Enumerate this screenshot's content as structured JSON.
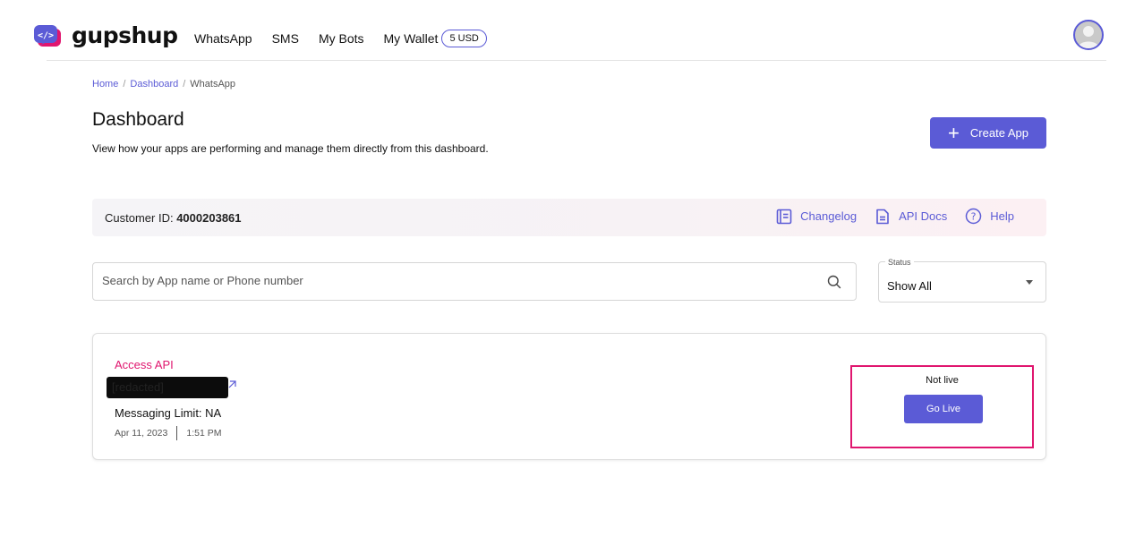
{
  "brand": {
    "name": "gupshup",
    "logo_icon": "code-bubble-icon",
    "accent": "#5b5bd6",
    "highlight": "#e0166f"
  },
  "nav": {
    "items": [
      "WhatsApp",
      "SMS",
      "My Bots"
    ],
    "wallet_label": "My Wallet",
    "wallet_balance": "5 USD"
  },
  "breadcrumb": {
    "home": "Home",
    "sep": "/",
    "dashboard": "Dashboard",
    "current": "WhatsApp"
  },
  "header": {
    "title": "Dashboard",
    "subtitle": "View how your apps are performing and manage them directly from this dashboard.",
    "create_button": "Create App"
  },
  "customer": {
    "id_label": "Customer ID:",
    "id_value": "4000203861",
    "links": {
      "changelog": "Changelog",
      "api_docs": "API Docs",
      "help": "Help"
    }
  },
  "search": {
    "placeholder": "Search by App name or Phone number"
  },
  "status_filter": {
    "label": "Status",
    "value": "Show All"
  },
  "app_card": {
    "access_label": "Access API",
    "app_name": "[redacted]",
    "messaging_limit": "Messaging Limit: NA",
    "date": "Apr 11, 2023",
    "time": "1:51 PM",
    "live_status": "Not live",
    "go_live_button": "Go Live"
  }
}
